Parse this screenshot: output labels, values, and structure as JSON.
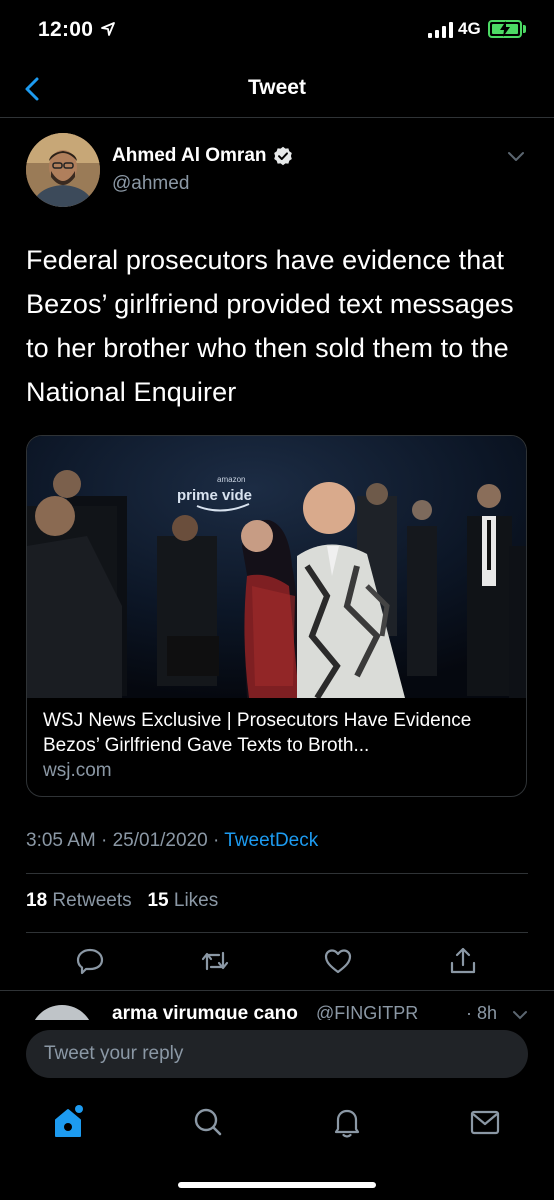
{
  "status_bar": {
    "time": "12:00",
    "network": "4G"
  },
  "nav": {
    "title": "Tweet"
  },
  "tweet": {
    "author_name": "Ahmed Al Omran",
    "author_handle": "@ahmed",
    "text": "Federal prosecutors have evidence that Bezos’ girlfriend provided text messages to her brother who then sold them to the National Enquirer",
    "card": {
      "title": "WSJ News Exclusive | Prosecutors Have Evidence Bezos’ Girlfriend Gave Texts to Broth...",
      "domain": "wsj.com",
      "image_sign_text": "amazon prime video"
    },
    "time": "3:05 AM",
    "date": "25/01/2020",
    "separator": "·",
    "source": "TweetDeck",
    "retweets_count": "18",
    "retweets_label": "Retweets",
    "likes_count": "15",
    "likes_label": "Likes"
  },
  "reply_preview": {
    "name": "arma virumque cano",
    "handle": "@FINGITPR",
    "time": "· 8h"
  },
  "reply_box": {
    "placeholder": "Tweet your reply"
  },
  "icons": {
    "back": "chevron-left-icon",
    "more": "chevron-down-icon",
    "verified": "verified-badge-icon",
    "reply": "comment-icon",
    "retweet": "retweet-icon",
    "like": "heart-icon",
    "share": "share-icon",
    "home": "home-icon",
    "search": "search-icon",
    "notifications": "bell-icon",
    "messages": "mail-icon"
  },
  "colors": {
    "accent": "#1d9bf0",
    "background": "#000000",
    "secondary_text": "#8b98a5",
    "divider": "#2f3336",
    "battery": "#4cd964"
  }
}
